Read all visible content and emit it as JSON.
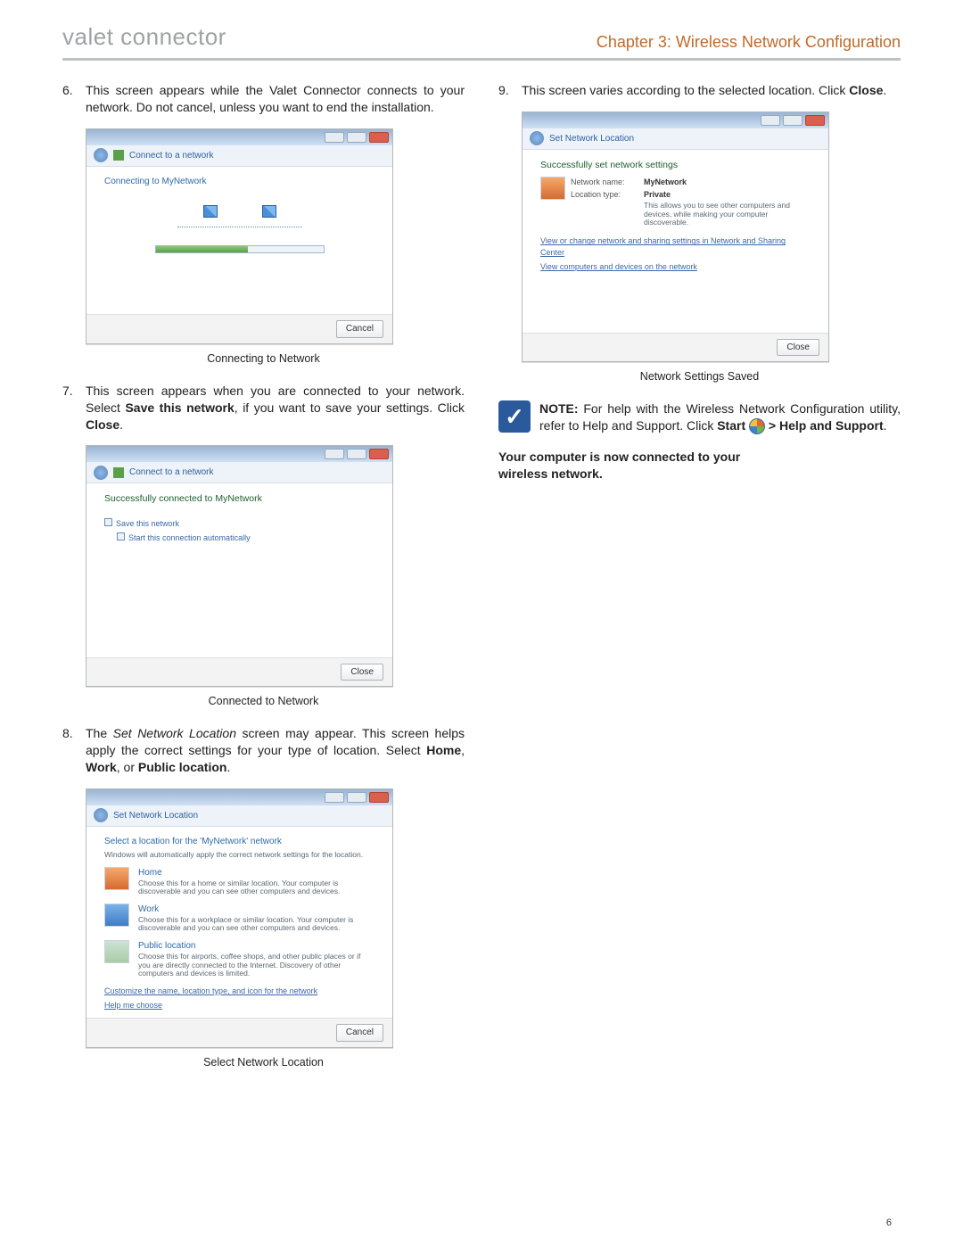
{
  "header": {
    "brand_logo": "valet",
    "brand_product": "connector",
    "chapter_title": "Chapter 3: Wireless Network Configuration"
  },
  "left_steps": {
    "s6": {
      "text_a": "This screen appears while the Valet Connector connects to your network. Do not cancel, unless you want to end the installation."
    },
    "s7": {
      "text_a": "This screen appears when you are connected to your network. Select ",
      "bold_a": "Save this network",
      "text_b": ", if you want to save your settings. Click ",
      "bold_b": "Close",
      "text_c": "."
    },
    "s8": {
      "text_a": "The ",
      "italic_a": "Set Network Location",
      "text_b": " screen may appear. This screen helps apply the correct settings for your type of location. Select ",
      "bold_a": "Home",
      "sep_a": ", ",
      "bold_b": "Work",
      "sep_b": ", or ",
      "bold_c": "Public location",
      "text_c": "."
    }
  },
  "right_steps": {
    "s9": {
      "text_a": "This screen varies according to the selected location. Click ",
      "bold_a": "Close",
      "text_b": "."
    }
  },
  "captions": {
    "c6": "Connecting to Network",
    "c7": "Connected to Network",
    "c8": "Select Network Location",
    "c9": "Network Settings Saved"
  },
  "shots": {
    "s6": {
      "toolbar_title": "Connect to a network",
      "heading": "Connecting to MyNetwork",
      "cancel": "Cancel"
    },
    "s7": {
      "toolbar_title": "Connect to a network",
      "heading": "Successfully connected to MyNetwork",
      "opt1": "Save this network",
      "opt2": "Start this connection automatically",
      "close": "Close"
    },
    "s8": {
      "toolbar_title": "Set Network Location",
      "heading": "Select a location for the 'MyNetwork' network",
      "sub": "Windows will automatically apply the correct network settings for the location.",
      "home_t": "Home",
      "home_d": "Choose this for a home or similar location. Your computer is discoverable and you can see other computers and devices.",
      "work_t": "Work",
      "work_d": "Choose this for a workplace or similar location. Your computer is discoverable and you can see other computers and devices.",
      "public_t": "Public location",
      "public_d": "Choose this for airports, coffee shops, and other public places or if you are directly connected to the Internet. Discovery of other computers and devices is limited.",
      "link1": "Customize the name, location type, and icon for the network",
      "link2": "Help me choose",
      "cancel": "Cancel"
    },
    "s9": {
      "toolbar_title": "Set Network Location",
      "heading": "Successfully set network settings",
      "k1": "Network name:",
      "v1": "MyNetwork",
      "k2": "Location type:",
      "v2": "Private",
      "desc": "This allows you to see other computers and devices, while making your computer discoverable.",
      "link1": "View or change network and sharing settings in Network and Sharing Center",
      "link2": "View computers and devices on the network",
      "close": "Close"
    }
  },
  "note": {
    "lead": "NOTE:",
    "text_a": " For help with the Wireless Network Configuration utility, refer to Help and Support. Click ",
    "bold_a": "Start",
    "sep": " > ",
    "bold_b": "Help and Support",
    "text_b": "."
  },
  "final": {
    "line1": "Your computer is now connected to your",
    "line2": "wireless network."
  },
  "page_number": "6"
}
